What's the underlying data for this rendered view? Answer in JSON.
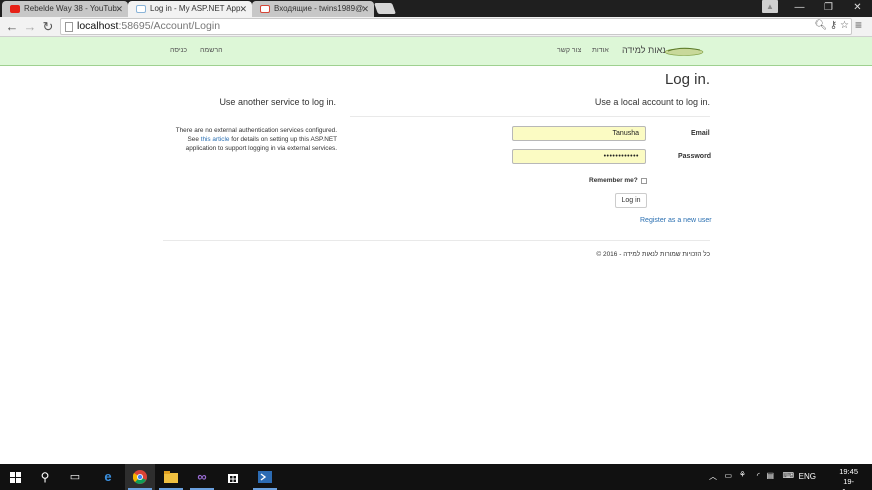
{
  "browser": {
    "tabs": [
      {
        "title": "Rebelde Way 38 - YouTub",
        "favicon": "youtube-icon",
        "color": "#e62117"
      },
      {
        "title": "Log in - My ASP.NET App",
        "favicon": "page-icon",
        "color": "#8ab4d8"
      },
      {
        "title": "Входящие - twins1989@",
        "favicon": "gmail-icon",
        "color": "#d44638"
      }
    ],
    "url_host": "localhost",
    "url_path": ":58695/Account/Login"
  },
  "site": {
    "brand": "נאות למידה",
    "nav": {
      "contact": "צור קשר",
      "about": "אודות",
      "register": "הרשמה",
      "login": "כניסה"
    },
    "nav_color": "#ddf7d7"
  },
  "page": {
    "title": "Log in.",
    "local_heading": "Use a local account to log in.",
    "external_heading": "Use another service to log in.",
    "email_label": "Email",
    "email_value": "Tanusha",
    "password_label": "Password",
    "password_value": "••••••••••••",
    "remember_label": "Remember me?",
    "login_button": "Log in",
    "register_link": "Register as a new user",
    "external_text_1": "There are no external authentication services configured.",
    "external_text_2a": "See ",
    "external_link": "this article",
    "external_text_2b": " for details on setting up this ASP.NET",
    "external_text_3": "application to support logging in via external services.",
    "footer": "© 2016 - כל הזכויות שמורות לנאות למידה"
  },
  "taskbar": {
    "language": "ENG",
    "time": "19:45",
    "date": "19-Jun-16"
  }
}
